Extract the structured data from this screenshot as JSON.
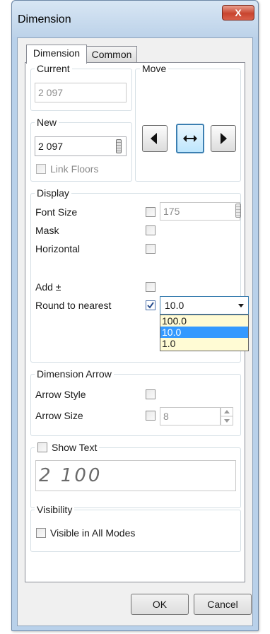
{
  "window": {
    "title": "Dimension",
    "close_label": "X"
  },
  "tabs": [
    {
      "label": "Dimension"
    },
    {
      "label": "Common"
    }
  ],
  "current": {
    "legend": "Current",
    "value": "2 097"
  },
  "move": {
    "legend": "Move",
    "left_icon": "triangle-left-icon",
    "center_icon": "double-arrow-icon",
    "right_icon": "triangle-right-icon"
  },
  "new": {
    "legend": "New",
    "value": "2 097",
    "link_floors_label": "Link Floors",
    "link_floors_checked": false
  },
  "display": {
    "legend": "Display",
    "font_size_label": "Font Size",
    "font_size_value": "175",
    "mask_label": "Mask",
    "horizontal_label": "Horizontal",
    "add_pm_label": "Add ±",
    "round_label": "Round to nearest",
    "round_checked": true,
    "round_selected": "10.0",
    "round_options": [
      "100.0",
      "10.0",
      "1.0"
    ]
  },
  "arrow": {
    "legend": "Dimension Arrow",
    "style_label": "Arrow Style",
    "size_label": "Arrow Size",
    "size_value": "8"
  },
  "show_text": {
    "label": "Show Text",
    "checked": false,
    "preview": "2 100"
  },
  "visibility": {
    "legend": "Visibility",
    "visible_all_label": "Visible in All Modes",
    "checked": false
  },
  "buttons": {
    "ok": "OK",
    "cancel": "Cancel"
  },
  "colors": {
    "frame": "#b9d1ea",
    "selection": "#3399ff",
    "dropdown_bg": "#fffbd4",
    "focus_border": "#3c7fb1"
  }
}
